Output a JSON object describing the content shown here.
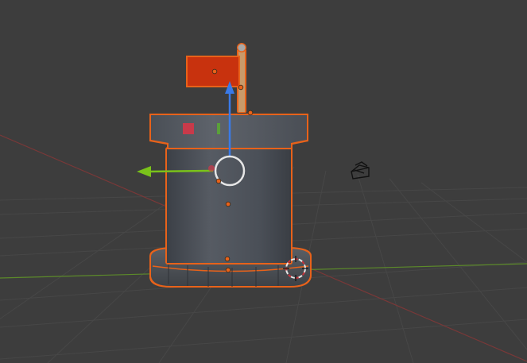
{
  "viewport": {
    "background": "#3d3d3d",
    "grid_color": "#4a4a4a",
    "x_axis_color": "#8a3a3a",
    "y_axis_color": "#5c8a2a"
  },
  "selection": {
    "outline_color": "#e8621a",
    "origin_color": "#e8621a"
  },
  "gizmo": {
    "z_arrow_color": "#3a7ae8",
    "x_arrow_color": "#7ac21a",
    "center_ring_color": "#e0e0e0"
  },
  "object": {
    "body_color": "#4a4f57",
    "flag_color": "#c8320e",
    "pole_color": "#c89a6a",
    "accent_red": "#c83a4a",
    "accent_green": "#5aa03a"
  },
  "icons": {
    "camera": "camera-icon",
    "cursor_3d": "3d-cursor-icon"
  }
}
